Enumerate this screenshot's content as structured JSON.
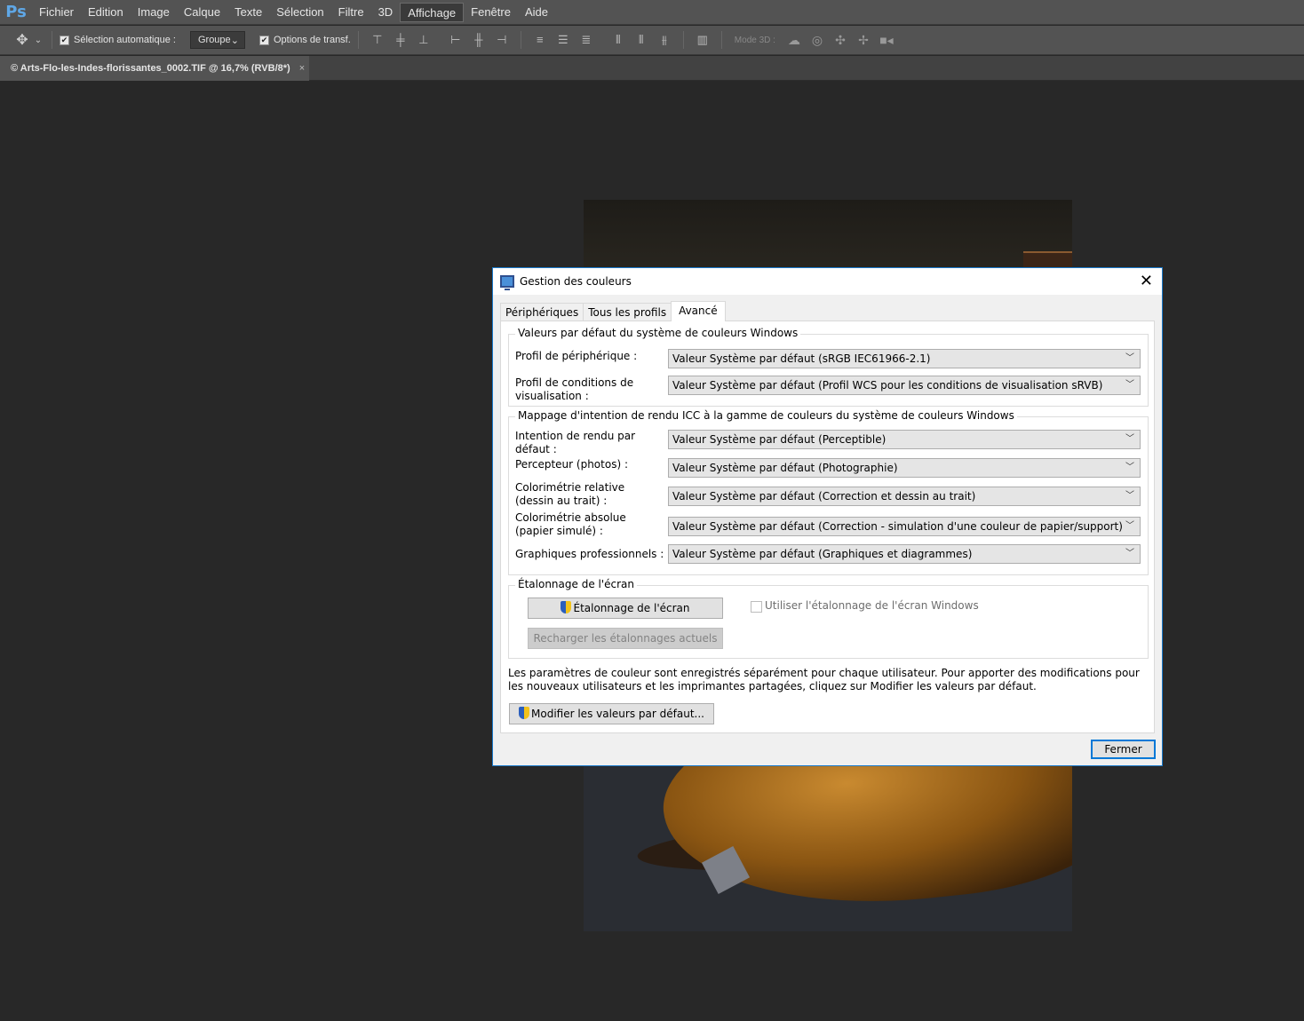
{
  "app": {
    "logo": "Ps",
    "menu": [
      "Fichier",
      "Edition",
      "Image",
      "Calque",
      "Texte",
      "Sélection",
      "Filtre",
      "3D",
      "Affichage",
      "Fenêtre",
      "Aide"
    ],
    "active_menu": "Affichage"
  },
  "options_bar": {
    "auto_select_label": "Sélection automatique :",
    "auto_select_value": "Groupe",
    "transform_label": "Options de transf.",
    "mode3d_label": "Mode 3D :"
  },
  "document": {
    "tab_title": "© Arts-Flo-les-Indes-florissantes_0002.TIF @ 16,7% (RVB/8*)",
    "close": "×"
  },
  "dialog": {
    "title": "Gestion des couleurs",
    "tabs": [
      "Périphériques",
      "Tous les profils",
      "Avancé"
    ],
    "selected_tab": "Avancé",
    "group1": {
      "title": "Valeurs par défaut du système de couleurs Windows",
      "rows": [
        {
          "label": "Profil de périphérique :",
          "value": "Valeur Système par défaut (sRGB IEC61966-2.1)"
        },
        {
          "label": "Profil de conditions de visualisation :",
          "value": "Valeur Système par défaut (Profil WCS pour les conditions de visualisation sRVB)"
        }
      ]
    },
    "group2": {
      "title": "Mappage d'intention de rendu ICC à la gamme de couleurs du système de couleurs Windows",
      "rows": [
        {
          "label": "Intention de rendu par défaut :",
          "value": "Valeur Système par défaut (Perceptible)"
        },
        {
          "label": "Percepteur (photos) :",
          "value": "Valeur Système par défaut (Photographie)"
        },
        {
          "label": "Colorimétrie relative (dessin au trait) :",
          "value": "Valeur Système par défaut (Correction et dessin au trait)"
        },
        {
          "label": "Colorimétrie absolue (papier simulé) :",
          "value": "Valeur Système par défaut (Correction - simulation d'une couleur de papier/support)"
        },
        {
          "label": "Graphiques professionnels :",
          "value": "Valeur Système par défaut (Graphiques et diagrammes)"
        }
      ]
    },
    "group3": {
      "title": "Étalonnage de l'écran",
      "calibrate_button": "Étalonnage de l'écran",
      "reload_button": "Recharger les étalonnages actuels",
      "checkbox_label": "Utiliser l'étalonnage de l'écran Windows"
    },
    "info_text": "Les paramètres de couleur sont enregistrés séparément pour chaque utilisateur. Pour apporter des modifications pour les nouveaux utilisateurs et les imprimantes partagées, cliquez sur Modifier les valeurs par défaut.",
    "modify_button": "Modifier les valeurs par défaut...",
    "close_button": "Fermer"
  }
}
